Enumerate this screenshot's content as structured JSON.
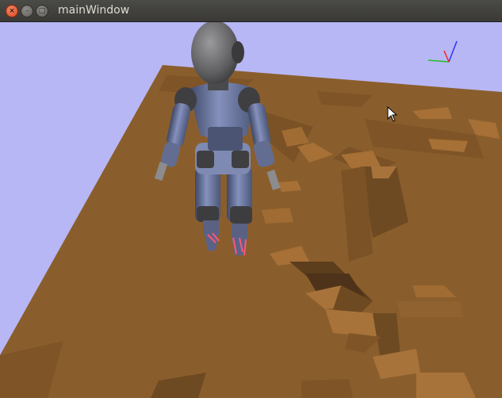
{
  "window": {
    "title": "mainWindow",
    "controls": {
      "close": "×",
      "minimize": "–",
      "maximize": "□"
    }
  },
  "viewport": {
    "scene": "3D humanoid robot standing on brown terrain",
    "background_color": "#b8b7f5",
    "terrain_color": "#8a5e2c",
    "robot_color": "#6c7aa8",
    "axis_colors": {
      "x": "#ff2020",
      "y": "#20c020",
      "z": "#3030ff"
    }
  },
  "icons": {
    "cursor": "mouse-pointer-icon",
    "axes": "axis-gizmo-icon"
  }
}
